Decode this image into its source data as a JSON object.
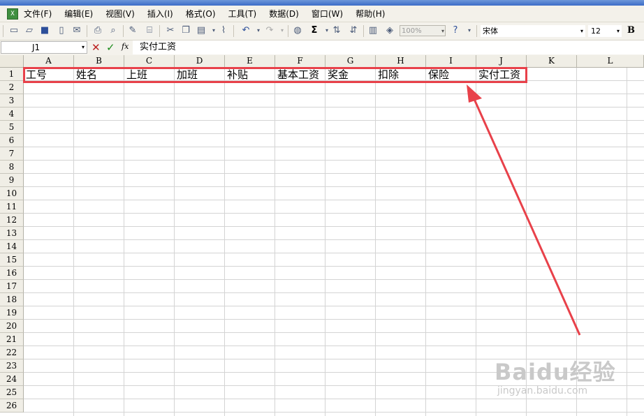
{
  "menu": {
    "app_icon_label": "X",
    "items": [
      "文件(F)",
      "编辑(E)",
      "视图(V)",
      "插入(I)",
      "格式(O)",
      "工具(T)",
      "数据(D)",
      "窗口(W)",
      "帮助(H)"
    ]
  },
  "toolbar": {
    "zoom": "100%",
    "font_name": "宋体",
    "font_size": "12",
    "bold_label": "B",
    "sum_glyph": "Σ"
  },
  "formula_bar": {
    "name_box": "J1",
    "cancel_glyph": "✕",
    "enter_glyph": "✓",
    "fx_label": "fx",
    "formula": "实付工资"
  },
  "sheet": {
    "columns": [
      "A",
      "B",
      "C",
      "D",
      "E",
      "F",
      "G",
      "H",
      "I",
      "J",
      "K",
      "L"
    ],
    "rows": [
      "1",
      "2",
      "3",
      "4",
      "5",
      "6",
      "7",
      "8",
      "9",
      "10",
      "11",
      "12",
      "13",
      "14",
      "15",
      "16",
      "17",
      "18",
      "19",
      "20",
      "21",
      "22",
      "23",
      "24",
      "25",
      "26"
    ],
    "row1": [
      "工号",
      "姓名",
      "上班",
      "加班",
      "补贴",
      "基本工资",
      "奖金",
      "扣除",
      "保险",
      "实付工资"
    ]
  },
  "annotation": {
    "highlight_color": "#e8414a"
  },
  "watermark": {
    "text": "Baidu经验",
    "sub": "jingyan.baidu.com"
  }
}
